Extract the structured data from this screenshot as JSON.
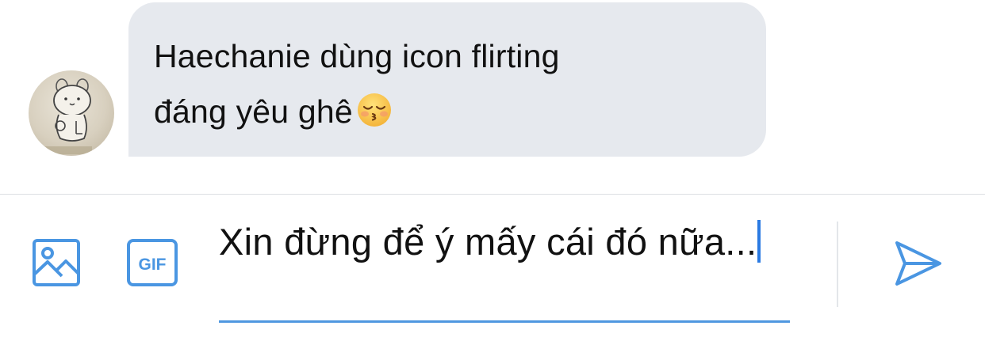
{
  "conversation": {
    "incoming_message": {
      "lines": [
        "Haechanie dùng icon flirting",
        "đáng yêu ghê"
      ],
      "emoji": "kissing-face-with-closed-eyes"
    }
  },
  "composer": {
    "draft_text": "Xin đừng để ý mấy cái đó nữa...",
    "photo_icon": "image-icon",
    "gif_label": "GIF",
    "send_icon": "send-icon",
    "accent_color": "#4a96e2"
  }
}
